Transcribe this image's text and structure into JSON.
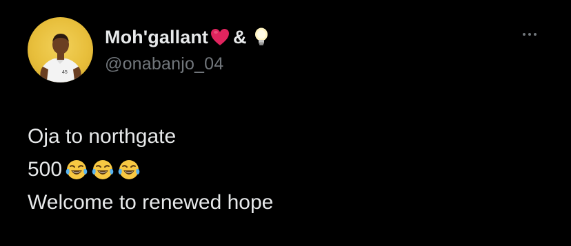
{
  "author": {
    "display_name": "Moh'gallant",
    "name_suffix": "&",
    "handle": "@onabanjo_04",
    "heart_icon": "red-heart-icon",
    "bulb_icon": "light-bulb-icon",
    "avatar_bg": "#e8bf3c"
  },
  "tweet": {
    "line1": "Oja to northgate",
    "line2_text": "500",
    "line2_emoji": "face-with-tears-of-joy-icon",
    "line2_emoji_count": 3,
    "line3": "Welcome to renewed hope"
  },
  "colors": {
    "background": "#000000",
    "text_primary": "#e7e9ea",
    "text_secondary": "#71767b",
    "heart": "#e0245e"
  }
}
